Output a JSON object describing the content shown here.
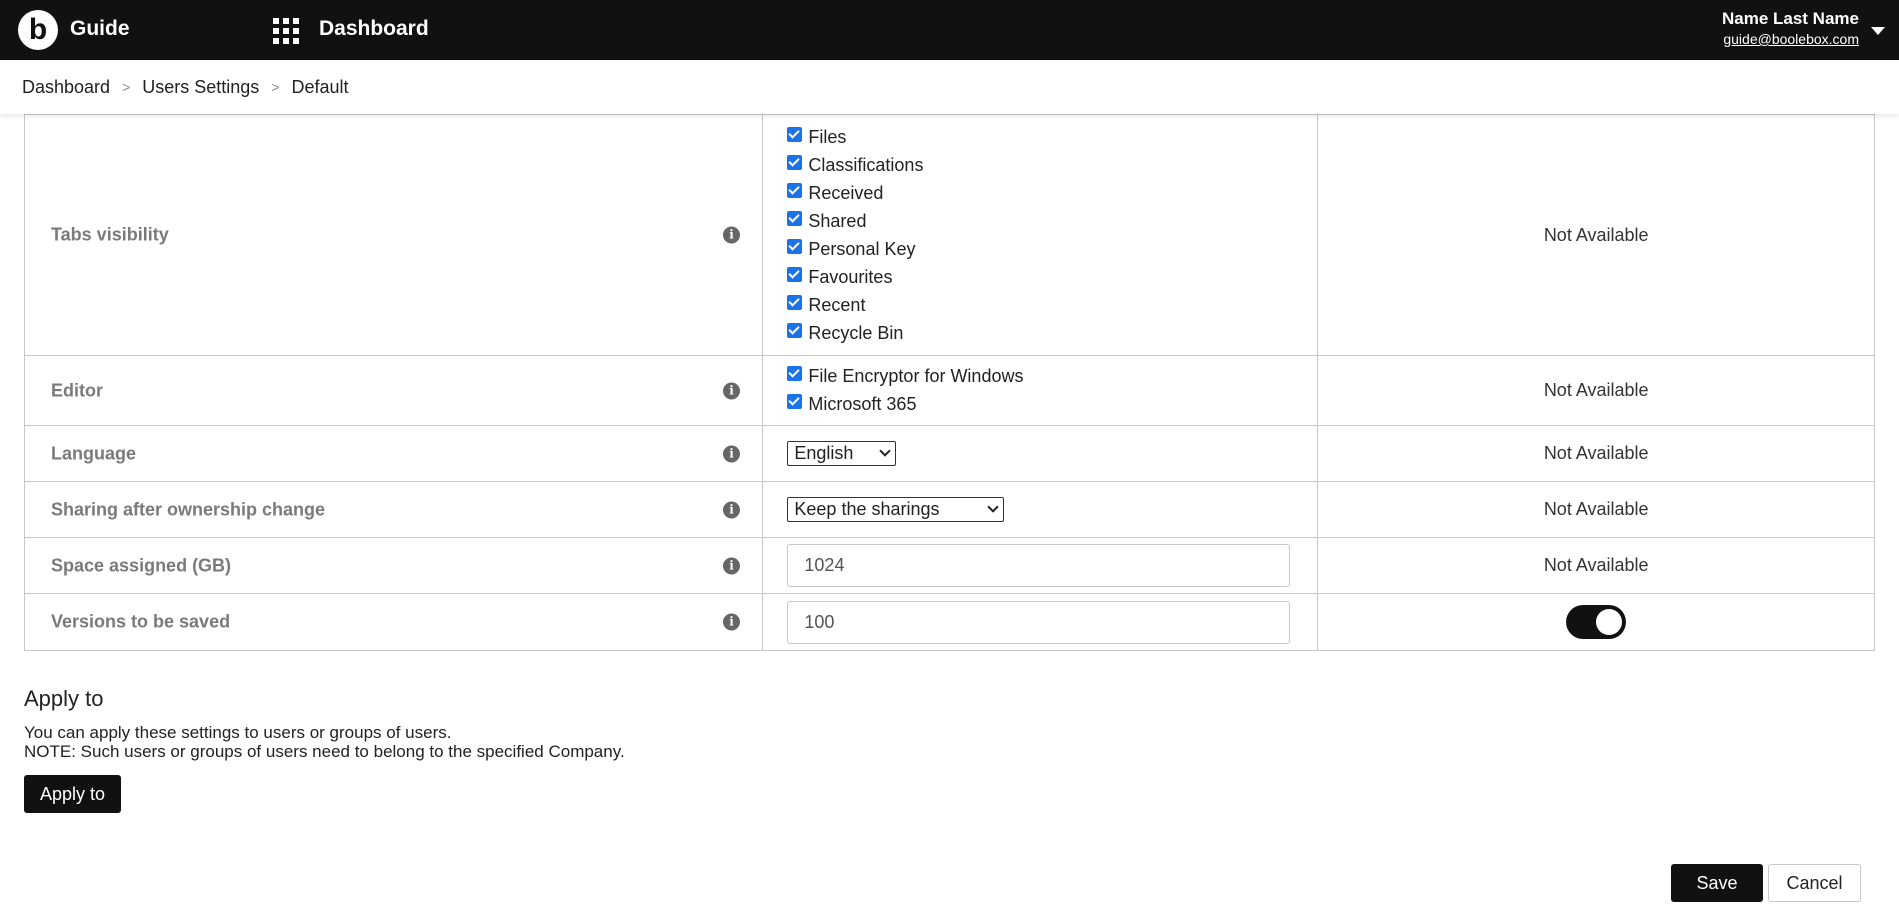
{
  "header": {
    "logo_letter": "b",
    "app_name": "Guide",
    "section_title": "Dashboard",
    "user_name": "Name Last Name",
    "user_email": "guide@boolebox.com"
  },
  "breadcrumb": [
    "Dashboard",
    "Users Settings",
    "Default"
  ],
  "breadcrumb_separator": ">",
  "info_symbol": "i",
  "settings": {
    "tabs_visibility": {
      "label": "Tabs visibility",
      "options": [
        "Files",
        "Classifications",
        "Received",
        "Shared",
        "Personal Key",
        "Favourites",
        "Recent",
        "Recycle Bin"
      ],
      "checked": [
        true,
        true,
        true,
        true,
        true,
        true,
        true,
        true
      ],
      "extra": "Not Available"
    },
    "editor": {
      "label": "Editor",
      "options": [
        "File Encryptor for Windows",
        "Microsoft 365"
      ],
      "checked": [
        true,
        true
      ],
      "extra": "Not Available"
    },
    "language": {
      "label": "Language",
      "selected": "English",
      "extra": "Not Available"
    },
    "sharing": {
      "label": "Sharing after ownership change",
      "selected": "Keep the sharings",
      "extra": "Not Available"
    },
    "space": {
      "label": "Space assigned (GB)",
      "value": "1024",
      "extra": "Not Available"
    },
    "versions": {
      "label": "Versions to be saved",
      "value": "100",
      "toggle_on": true
    }
  },
  "apply": {
    "title": "Apply to",
    "description_line1": "You can apply these settings to users or groups of users.",
    "description_line2": "NOTE: Such users or groups of users need to belong to the specified Company.",
    "button_label": "Apply to"
  },
  "footer": {
    "save_label": "Save",
    "cancel_label": "Cancel"
  },
  "colors": {
    "topbar_bg": "#111111",
    "checkbox_accent": "#1a73e8",
    "label_gray": "#7a7a7a",
    "border": "#c7c7c7"
  },
  "icons": [
    "logo-icon",
    "apps-grid-icon",
    "caret-down-icon",
    "info-icon",
    "checkbox-checked-icon",
    "select-chevron-icon"
  ]
}
